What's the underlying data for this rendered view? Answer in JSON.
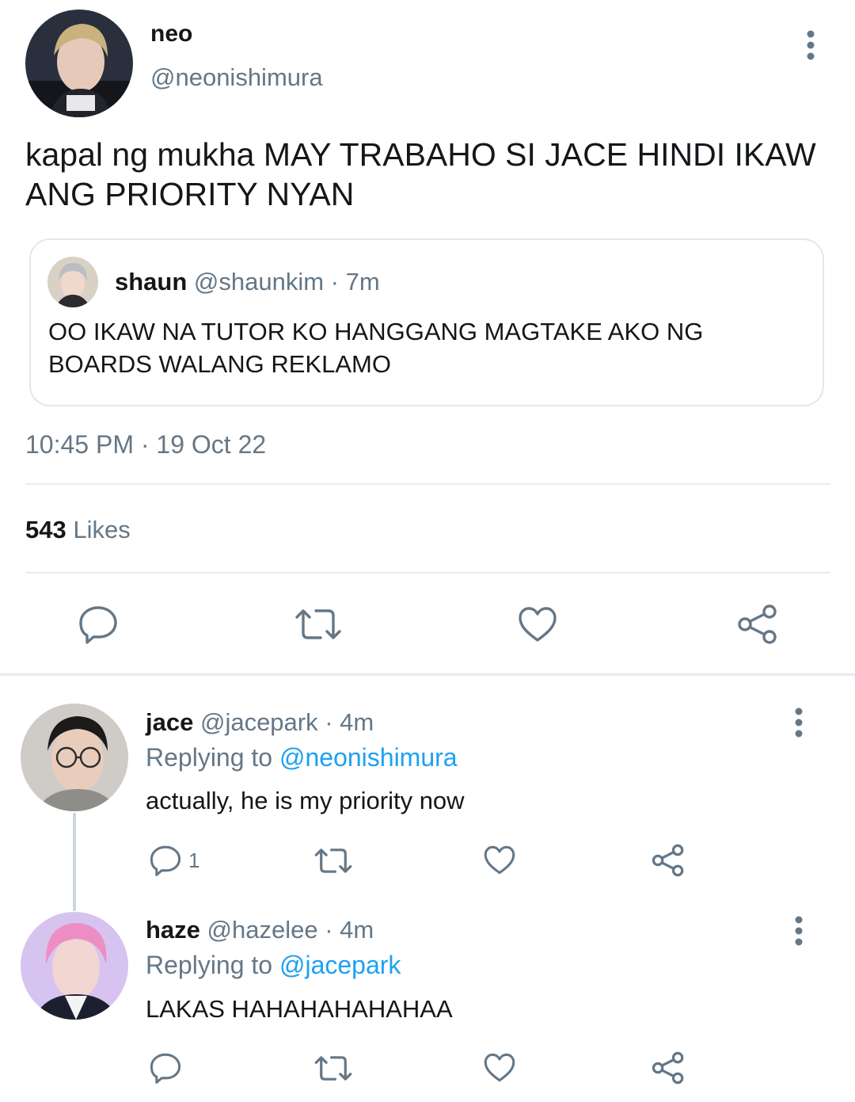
{
  "main_tweet": {
    "display_name": "neo",
    "handle": "@neonishimura",
    "text": "kapal ng mukha MAY TRABAHO SI JACE HINDI IKAW ANG PRIORITY NYAN",
    "quoted": {
      "display_name": "shaun",
      "handle_time": "@shaunkim · 7m",
      "text": "OO IKAW NA TUTOR KO HANGGANG MAGTAKE AKO NG BOARDS WALANG REKLAMO"
    },
    "timestamp": "10:45 PM · 19 Oct 22",
    "likes_count": "543",
    "likes_label": "Likes"
  },
  "replies": [
    {
      "display_name": "jace",
      "handle_time": "@jacepark · 4m",
      "replying_label": "Replying to",
      "replying_to": "@neonishimura",
      "text": "actually, he is my priority now",
      "reply_count": "1"
    },
    {
      "display_name": "haze",
      "handle_time": "@hazelee · 4m",
      "replying_label": "Replying to",
      "replying_to": "@jacepark",
      "text": "LAKAS HAHAHAHAHAHAA",
      "reply_count": ""
    }
  ],
  "icons": {
    "more": "more-vertical-icon",
    "reply": "reply-bubble-icon",
    "retweet": "retweet-icon",
    "like": "heart-icon",
    "share": "share-icon"
  },
  "colors": {
    "link_blue": "#1da1f2",
    "secondary_text": "#657786",
    "divider": "#e6ecf0"
  }
}
